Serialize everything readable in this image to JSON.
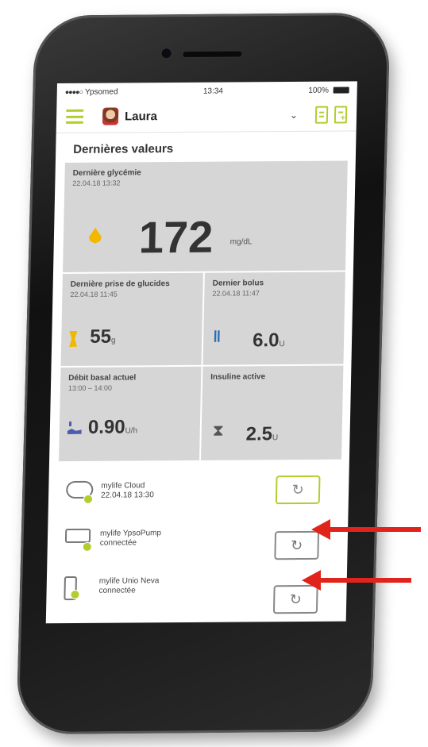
{
  "status_bar": {
    "carrier": "Ypsomed",
    "time": "13:34",
    "battery": "100%"
  },
  "header": {
    "user_name": "Laura"
  },
  "section_title": "Dernières valeurs",
  "last_glucose": {
    "label": "Dernière glycémie",
    "timestamp": "22.04.18  13:32",
    "value": "172",
    "unit": "mg/dL"
  },
  "carbs": {
    "label": "Dernière prise de glucides",
    "timestamp": "22.04.18  11:45",
    "value": "55",
    "unit": "g"
  },
  "bolus": {
    "label": "Dernier bolus",
    "timestamp": "22.04.18  11:47",
    "value": "6.0",
    "unit": "U"
  },
  "basal": {
    "label": "Débit basal actuel",
    "timestamp": "13:00 – 14:00",
    "value": "0.90",
    "unit": "U/h"
  },
  "active_insulin": {
    "label": "Insuline active",
    "value": "2.5",
    "unit": "U"
  },
  "connections": [
    {
      "name": "mylife Cloud",
      "status": "22.04.18  13:30"
    },
    {
      "name": "mylife YpsoPump",
      "status": "connectée"
    },
    {
      "name": "mylife Unio Neva",
      "status": "connectée"
    }
  ],
  "icons": {
    "sync": "↻",
    "chevron": "⌄",
    "fork": "🍴",
    "hourglass": "⧗"
  },
  "colors": {
    "accent": "#b5cc2e",
    "glucose": "#f2b800",
    "bolus": "#2d6fb3",
    "basal": "#4d5bb0",
    "arrow": "#e0241b"
  }
}
